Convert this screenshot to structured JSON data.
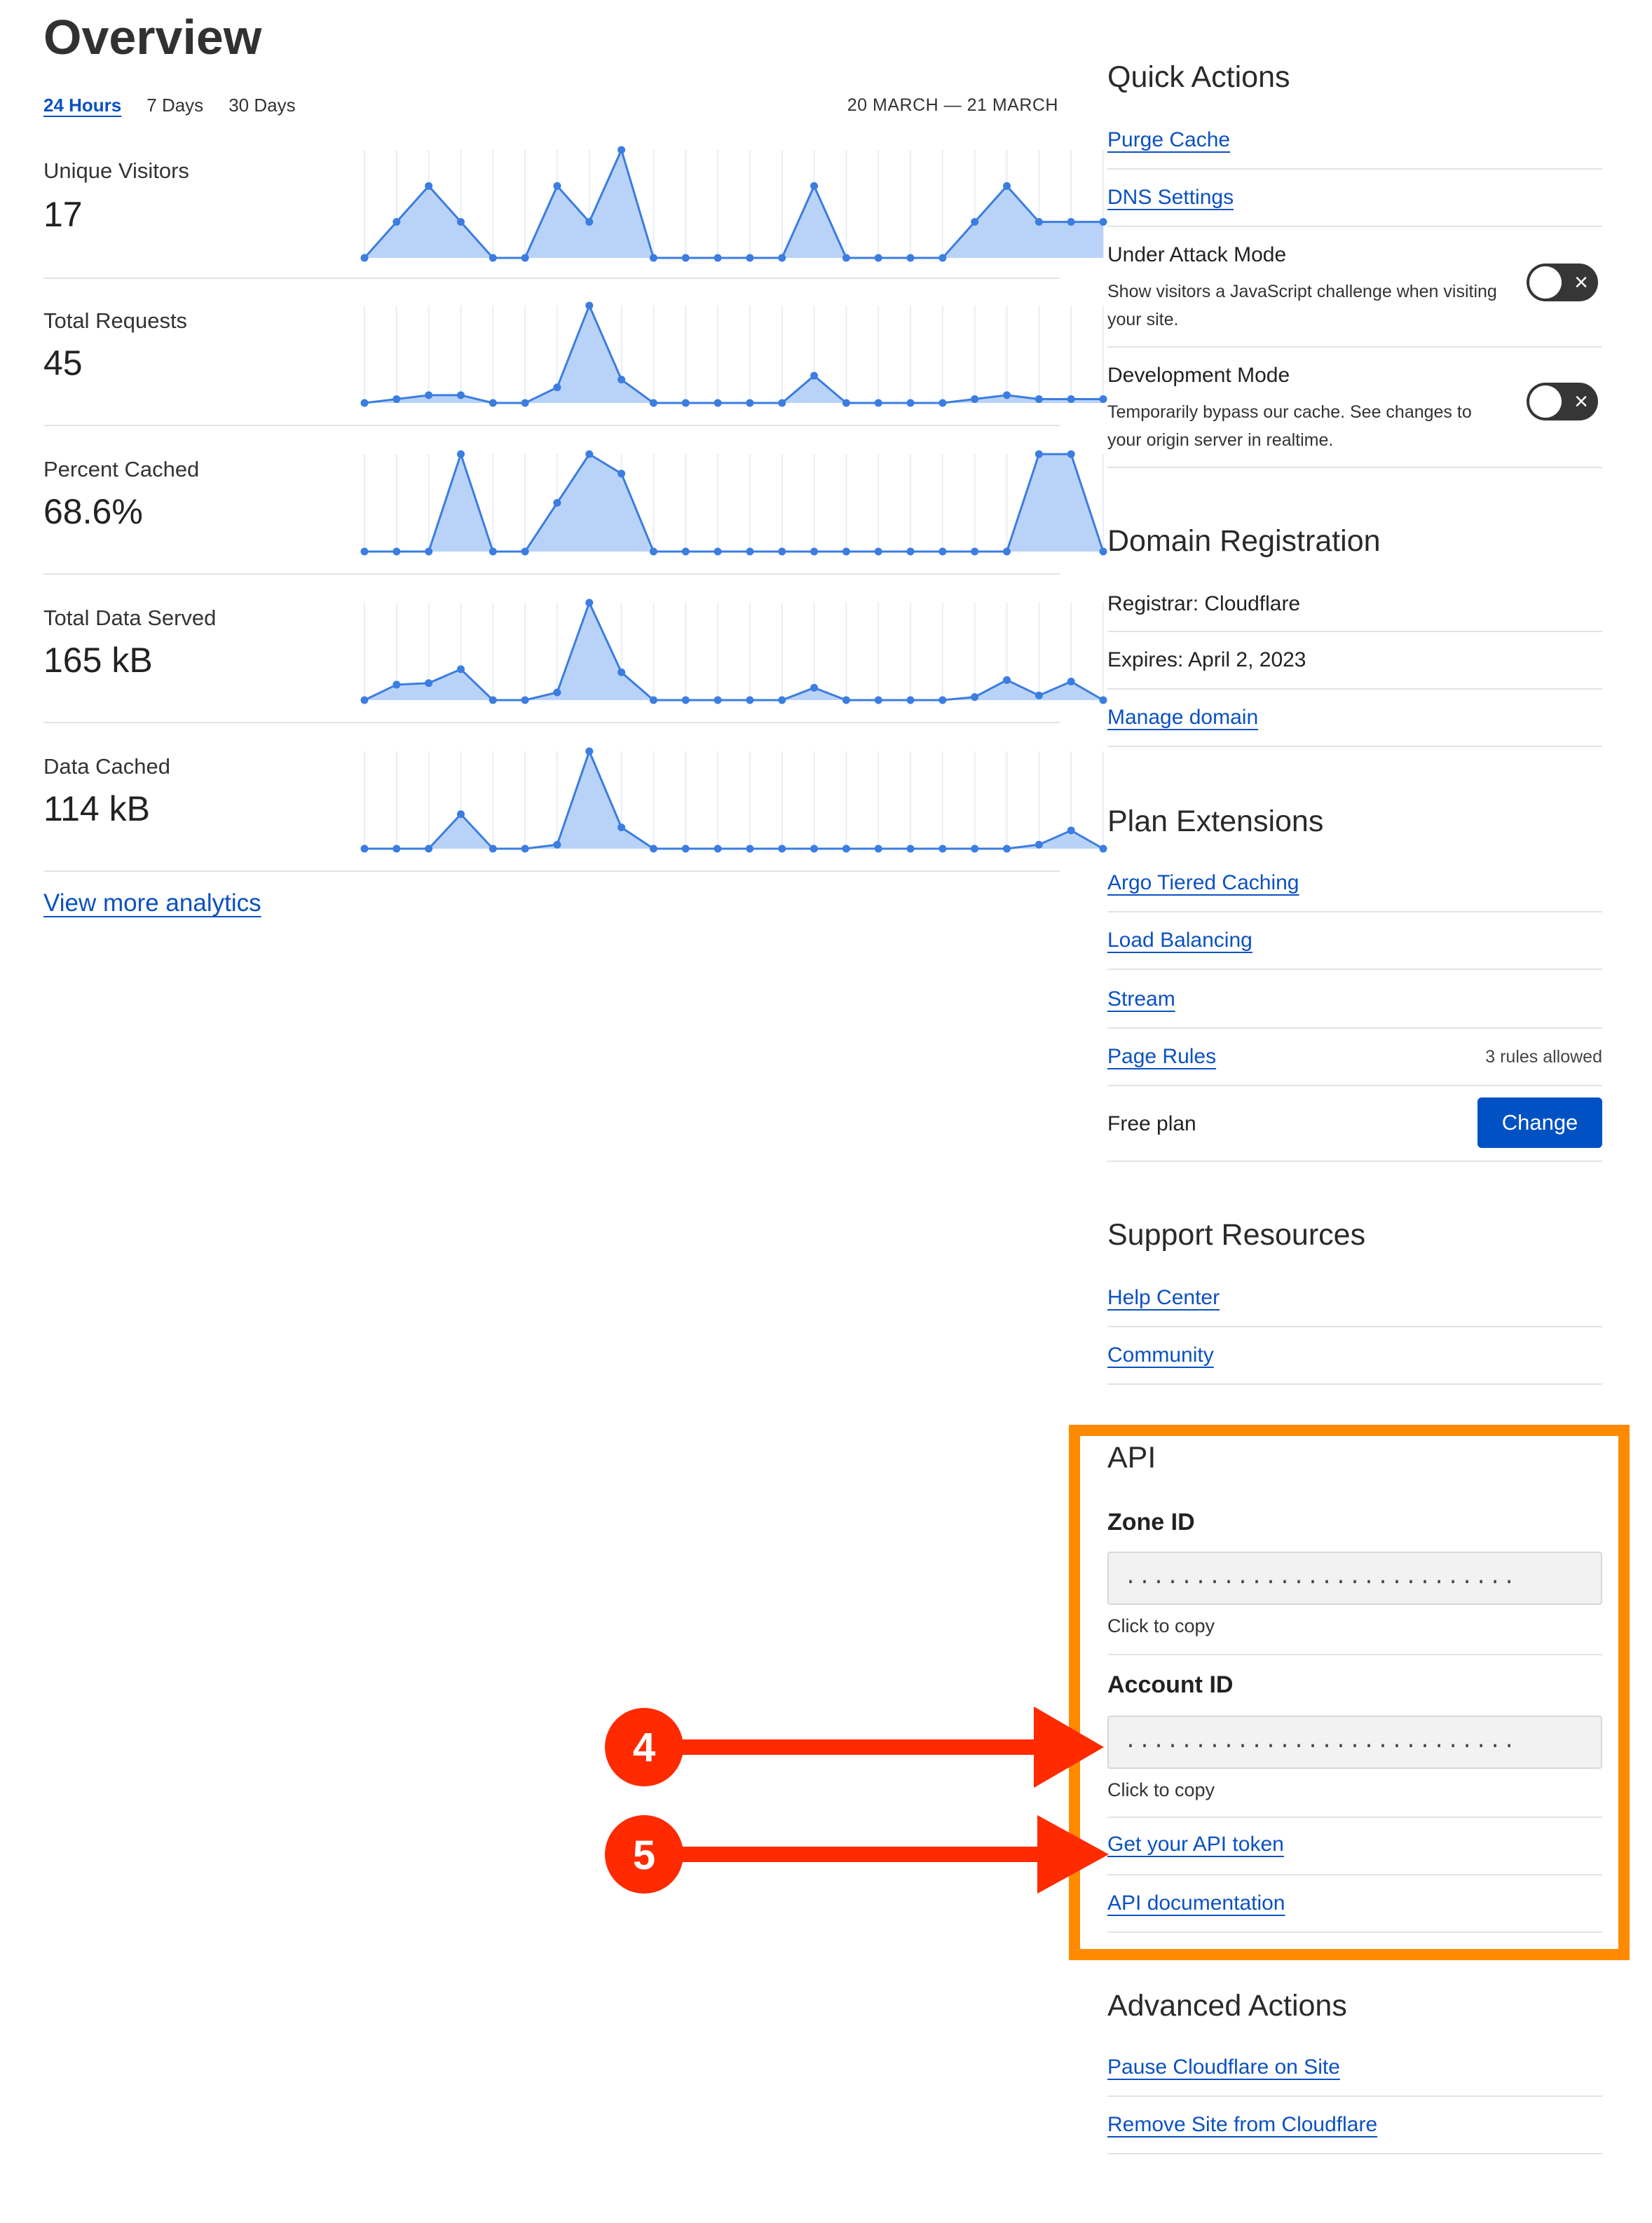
{
  "overview": {
    "title": "Overview",
    "tabs": [
      {
        "label": "24 Hours",
        "active": true
      },
      {
        "label": "7 Days",
        "active": false
      },
      {
        "label": "30 Days",
        "active": false
      }
    ],
    "date_range": "20 MARCH — 21 MARCH",
    "view_more": "View more analytics"
  },
  "metrics": [
    {
      "label": "Unique Visitors",
      "value": "17",
      "series": [
        0,
        1,
        2,
        1,
        0,
        0,
        2,
        1,
        3,
        0,
        0,
        0,
        0,
        0,
        2,
        0,
        0,
        0,
        0,
        1,
        2,
        1,
        1,
        1
      ]
    },
    {
      "label": "Total Requests",
      "value": "45",
      "series": [
        0,
        1,
        2,
        2,
        0,
        0,
        4,
        25,
        6,
        0,
        0,
        0,
        0,
        0,
        7,
        0,
        0,
        0,
        0,
        1,
        2,
        1,
        1,
        1
      ]
    },
    {
      "label": "Percent Cached",
      "value": "68.6%",
      "series": [
        0,
        0,
        0,
        100,
        0,
        0,
        50,
        100,
        80,
        0,
        0,
        0,
        0,
        0,
        0,
        0,
        0,
        0,
        0,
        0,
        0,
        100,
        100,
        0
      ]
    },
    {
      "label": "Total Data Served",
      "value": "165 kB",
      "series": [
        0,
        10,
        11,
        20,
        0,
        0,
        5,
        63,
        18,
        0,
        0,
        0,
        0,
        0,
        8,
        0,
        0,
        0,
        0,
        2,
        13,
        3,
        12,
        0
      ]
    },
    {
      "label": "Data Cached",
      "value": "114 kB",
      "series": [
        0,
        0,
        0,
        34,
        0,
        0,
        4,
        96,
        21,
        0,
        0,
        0,
        0,
        0,
        0,
        0,
        0,
        0,
        0,
        0,
        0,
        4,
        18,
        0
      ]
    }
  ],
  "chart_style": {
    "line": "#3b7de0",
    "fill": "#b9d3f8",
    "grid": "#e9eef6"
  },
  "quick_actions": {
    "title": "Quick Actions",
    "purge_cache": "Purge Cache",
    "dns_settings": "DNS Settings",
    "under_attack": {
      "title": "Under Attack Mode",
      "desc": "Show visitors a JavaScript challenge when visiting your site.",
      "enabled": false
    },
    "dev_mode": {
      "title": "Development Mode",
      "desc": "Temporarily bypass our cache. See changes to your origin server in realtime.",
      "enabled": false
    }
  },
  "domain_registration": {
    "title": "Domain Registration",
    "registrar": "Registrar: Cloudflare",
    "expires": "Expires: April 2, 2023",
    "manage": "Manage domain"
  },
  "plan_extensions": {
    "title": "Plan Extensions",
    "argo": "Argo Tiered Caching",
    "load_balancing": "Load Balancing",
    "stream": "Stream",
    "page_rules": "Page Rules",
    "page_rules_note": "3 rules allowed",
    "plan": "Free plan",
    "change": "Change"
  },
  "support": {
    "title": "Support Resources",
    "help_center": "Help Center",
    "community": "Community"
  },
  "api": {
    "title": "API",
    "zone_label": "Zone ID",
    "zone_value": "............................",
    "zone_hint": "Click to copy",
    "account_label": "Account ID",
    "account_value": "............................",
    "account_hint": "Click to copy",
    "get_token": "Get your API token",
    "docs": "API documentation"
  },
  "advanced": {
    "title": "Advanced Actions",
    "pause": "Pause Cloudflare on Site",
    "remove": "Remove Site from Cloudflare"
  },
  "annotations": [
    {
      "number": "4",
      "color": "#ff2a00"
    },
    {
      "number": "5",
      "color": "#ff2a00"
    }
  ],
  "highlight_color": "#ff8a00",
  "link_color": "#0b51c1",
  "button_color": "#0051c3"
}
